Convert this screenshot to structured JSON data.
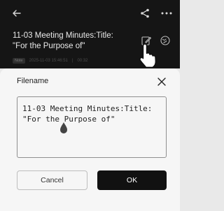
{
  "note": {
    "title": "11-03 Meeting Minutes:Title: \"For the Purpose of\"",
    "badge": "Note",
    "timestamp": "2025-11-03 15:46:51",
    "separator": "|",
    "duration": "00:32"
  },
  "dialog": {
    "heading": "Filename",
    "filename_value": "11-03 Meeting Minutes:Title: \"For the Purpose of\"",
    "cancel_label": "Cancel",
    "ok_label": "OK"
  },
  "icons": {
    "back": "arrow-left-icon",
    "share": "share-icon",
    "more": "more-dots-icon",
    "edit": "edit-icon",
    "translate": "globe-icon",
    "close": "close-icon",
    "cursor": "hand-pointer-icon",
    "text_handle": "text-drop-handle-icon"
  },
  "colors": {
    "header_bg": "#151515",
    "sheet_bg": "#f6f6f6",
    "ok_bg": "#111111"
  }
}
